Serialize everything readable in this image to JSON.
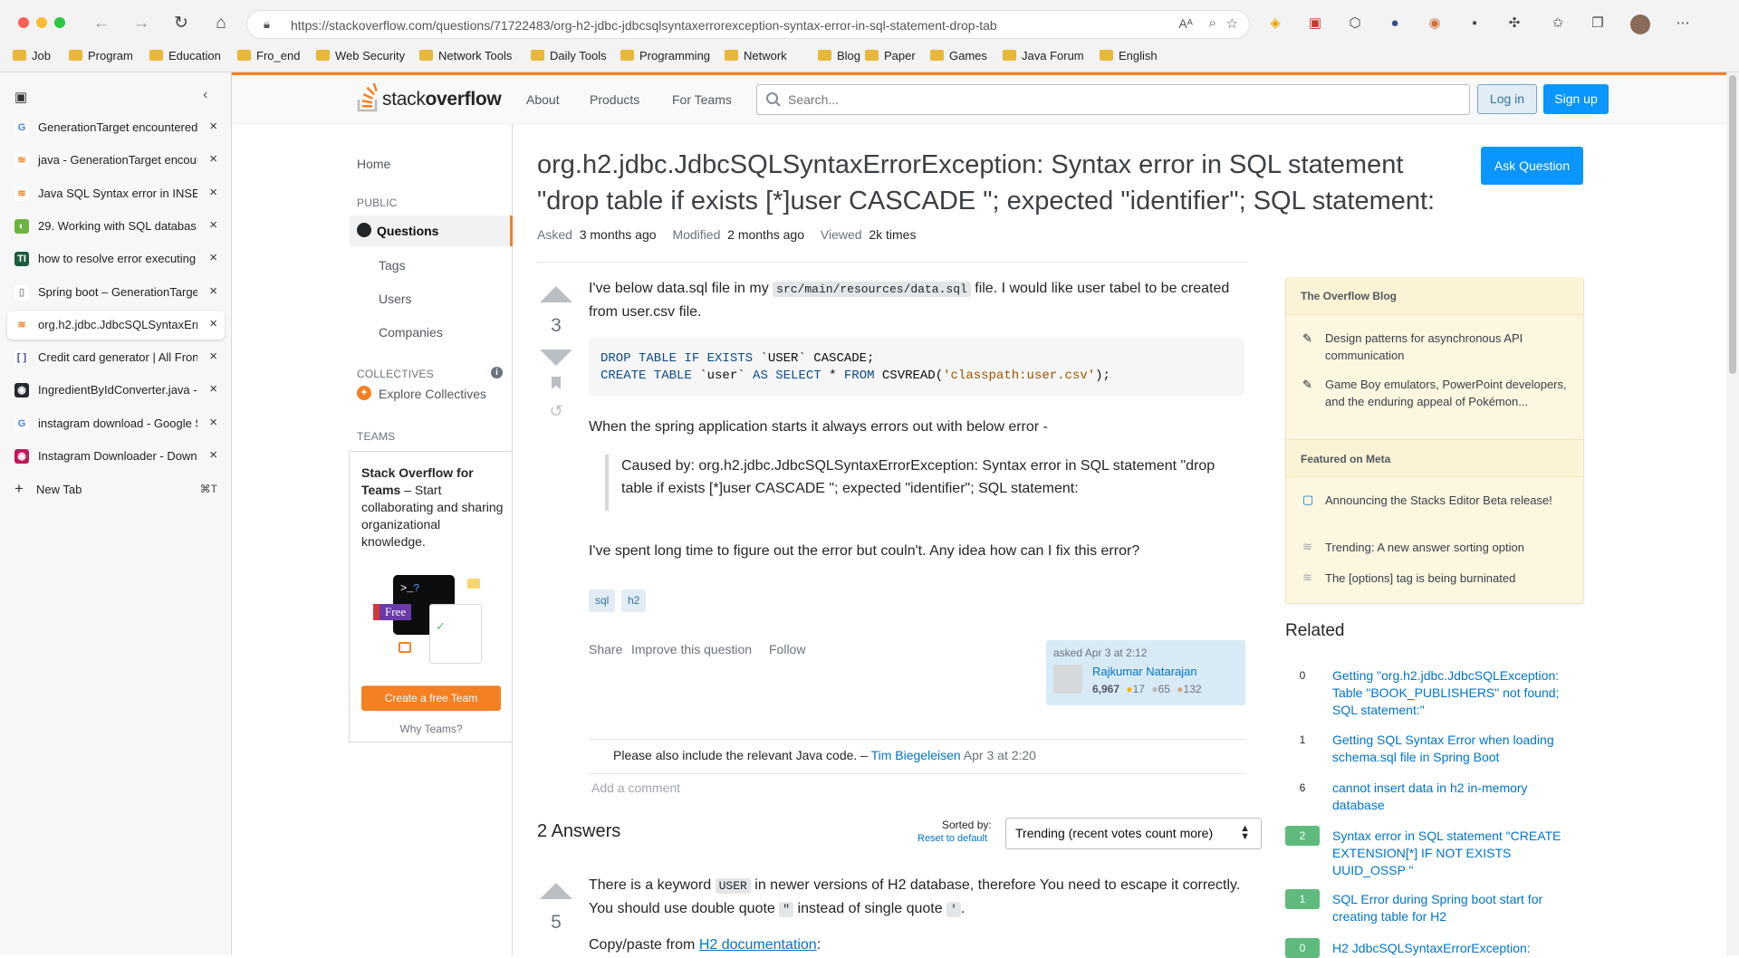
{
  "browser": {
    "url": "https://stackoverflow.com/questions/71722483/org-h2-jdbc-jdbcsqlsyntaxerrorexception-syntax-error-in-sql-statement-drop-tab",
    "bookmarks": [
      "Job",
      "Program",
      "Education",
      "Fro_end",
      "Web Security",
      "Network Tools",
      "Daily Tools",
      "Programming",
      "Network",
      "Blog",
      "Paper",
      "Games",
      "Java Forum",
      "English"
    ],
    "tabs": [
      {
        "title": "GenerationTarget encountered"
      },
      {
        "title": "java - GenerationTarget encoun"
      },
      {
        "title": "Java SQL Syntax error in INSER"
      },
      {
        "title": "29. Working with SQL databas"
      },
      {
        "title": "how to resolve error executing"
      },
      {
        "title": "Spring boot – GenerationTarget"
      },
      {
        "title": "org.h2.jdbc.JdbcSQLSyntaxErr"
      },
      {
        "title": "Credit card generator | All Fron"
      },
      {
        "title": "IngredientByIdConverter.java -"
      },
      {
        "title": "instagram download - Google S"
      },
      {
        "title": "Instagram Downloader - Downl"
      }
    ],
    "new_tab_label": "New Tab",
    "new_tab_shortcut": "⌘T"
  },
  "site": {
    "logo_text_1": "stack",
    "logo_text_2": "overflow",
    "nav": [
      "About",
      "Products",
      "For Teams"
    ],
    "search_placeholder": "Search...",
    "login": "Log in",
    "signup": "Sign up"
  },
  "leftnav": {
    "home": "Home",
    "public": "PUBLIC",
    "questions": "Questions",
    "tags": "Tags",
    "users": "Users",
    "companies": "Companies",
    "collectives": "COLLECTIVES",
    "explore_collectives": "Explore Collectives",
    "teams": "TEAMS",
    "teams_title": "Stack Overflow for Teams",
    "teams_desc": " – Start collaborating and sharing organizational knowledge.",
    "free_badge": "Free",
    "create_team": "Create a free Team",
    "why_teams": "Why Teams?"
  },
  "question": {
    "title": "org.h2.jdbc.JdbcSQLSyntaxErrorException: Syntax error in SQL statement \"drop table if exists [*]user CASCADE \"; expected \"identifier\"; SQL statement:",
    "ask_button": "Ask Question",
    "asked_label": "Asked",
    "asked_value": "3 months ago",
    "modified_label": "Modified",
    "modified_value": "2 months ago",
    "viewed_label": "Viewed",
    "viewed_value": "2k times",
    "votes": "3",
    "body_1a": "I've below data.sql file in my ",
    "body_1_code": "src/main/resources/data.sql",
    "body_1b": " file. I would like user tabel to be created from user.csv file.",
    "code_line1_kw": "DROP TABLE IF EXISTS",
    "code_line1_rest": " `USER` CASCADE;",
    "code_line2_kw1": "CREATE TABLE",
    "code_line2_mid": " `user` ",
    "code_line2_kw2": "AS SELECT",
    "code_line2_star": " * ",
    "code_line2_kw3": "FROM",
    "code_line2_fn": " CSVREAD(",
    "code_line2_str": "'classpath:user.csv'",
    "code_line2_end": ");",
    "body_2": "When the spring application starts it always errors out with below error -",
    "quote": "Caused by: org.h2.jdbc.JdbcSQLSyntaxErrorException: Syntax error in SQL statement \"drop table if exists [*]user CASCADE \"; expected \"identifier\"; SQL statement:",
    "body_3": "I've spent long time to figure out the error but couln't. Any idea how can I fix this error?",
    "tags": [
      "sql",
      "h2"
    ],
    "share": "Share",
    "improve": "Improve this question",
    "follow": "Follow",
    "asked_card": "asked Apr 3 at 2:12",
    "user_name": "Rajkumar Natarajan",
    "user_rep": "6,967",
    "badge_gold": "17",
    "badge_silver": "65",
    "badge_bronze": "132",
    "comment_text": "Please also include the relevant Java code. – ",
    "comment_user": "Tim Biegeleisen",
    "comment_time": " Apr 3 at 2:20",
    "add_comment": "Add a comment"
  },
  "answers": {
    "heading": "2 Answers",
    "sorted_by": "Sorted by:",
    "reset": "Reset to default",
    "sort_value": "Trending (recent votes count more)",
    "first_votes": "5",
    "first_body_a": "There is a keyword ",
    "first_body_code": "USER",
    "first_body_b": " in newer versions of H2 database, therefore You need to escape it correctly. You should use double quote ",
    "first_body_code2": "\"",
    "first_body_c": " instead of single quote ",
    "first_body_code3": "'",
    "first_body_d": ".",
    "copy_paste": "Copy/paste from ",
    "h2_link": "H2 documentation",
    "colon": ":"
  },
  "sidebar": {
    "blog_head": "The Overflow Blog",
    "blog_items": [
      "Design patterns for asynchronous API communication",
      "Game Boy emulators, PowerPoint developers, and the enduring appeal of Pokémon..."
    ],
    "meta_head": "Featured on Meta",
    "meta_items": [
      "Announcing the Stacks Editor Beta release!",
      "Trending: A new answer sorting option",
      "The [options] tag is being burninated"
    ],
    "related_head": "Related",
    "related": [
      {
        "count": "0",
        "title": "Getting \"org.h2.jdbc.JdbcSQLException: Table \"BOOK_PUBLISHERS\" not found; SQL statement:\""
      },
      {
        "count": "1",
        "title": "Getting SQL Syntax Error when loading schema.sql file in Spring Boot"
      },
      {
        "count": "6",
        "title": "cannot insert data in h2 in-memory database"
      },
      {
        "count": "2",
        "title": "Syntax error in SQL statement \"CREATE EXTENSION[*] IF NOT EXISTS UUID_OSSP \""
      },
      {
        "count": "1",
        "title": "SQL Error during Spring boot start for creating table for H2"
      },
      {
        "count": "0",
        "title": "H2 JdbcSQLSyntaxErrorException:"
      }
    ]
  },
  "colors": {
    "accent": "#f48024",
    "link": "#0074cc",
    "primary_button": "#0a95ff",
    "accepted_green": "#5eba7d"
  }
}
